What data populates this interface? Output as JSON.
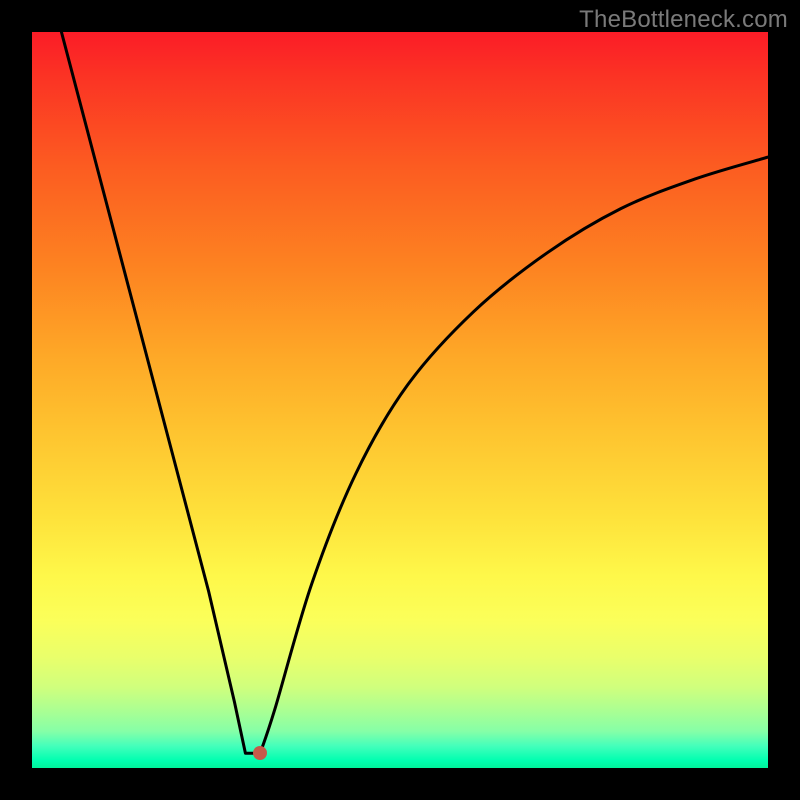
{
  "watermark": "TheBottleneck.com",
  "chart_data": {
    "type": "line",
    "title": "",
    "xlabel": "",
    "ylabel": "",
    "xlim": [
      0,
      1
    ],
    "ylim": [
      0,
      1
    ],
    "marker": {
      "x": 0.31,
      "y": 0.02
    },
    "curve_points": [
      {
        "x": 0.04,
        "y": 1.0
      },
      {
        "x": 0.09,
        "y": 0.81
      },
      {
        "x": 0.14,
        "y": 0.62
      },
      {
        "x": 0.19,
        "y": 0.43
      },
      {
        "x": 0.24,
        "y": 0.24
      },
      {
        "x": 0.275,
        "y": 0.09
      },
      {
        "x": 0.29,
        "y": 0.02
      },
      {
        "x": 0.31,
        "y": 0.02
      },
      {
        "x": 0.33,
        "y": 0.08
      },
      {
        "x": 0.38,
        "y": 0.25
      },
      {
        "x": 0.44,
        "y": 0.4
      },
      {
        "x": 0.51,
        "y": 0.52
      },
      {
        "x": 0.6,
        "y": 0.62
      },
      {
        "x": 0.7,
        "y": 0.7
      },
      {
        "x": 0.8,
        "y": 0.76
      },
      {
        "x": 0.9,
        "y": 0.8
      },
      {
        "x": 1.0,
        "y": 0.83
      }
    ],
    "background_gradient": {
      "top_color": "#fb1c27",
      "bottom_color": "#00f39b"
    }
  }
}
